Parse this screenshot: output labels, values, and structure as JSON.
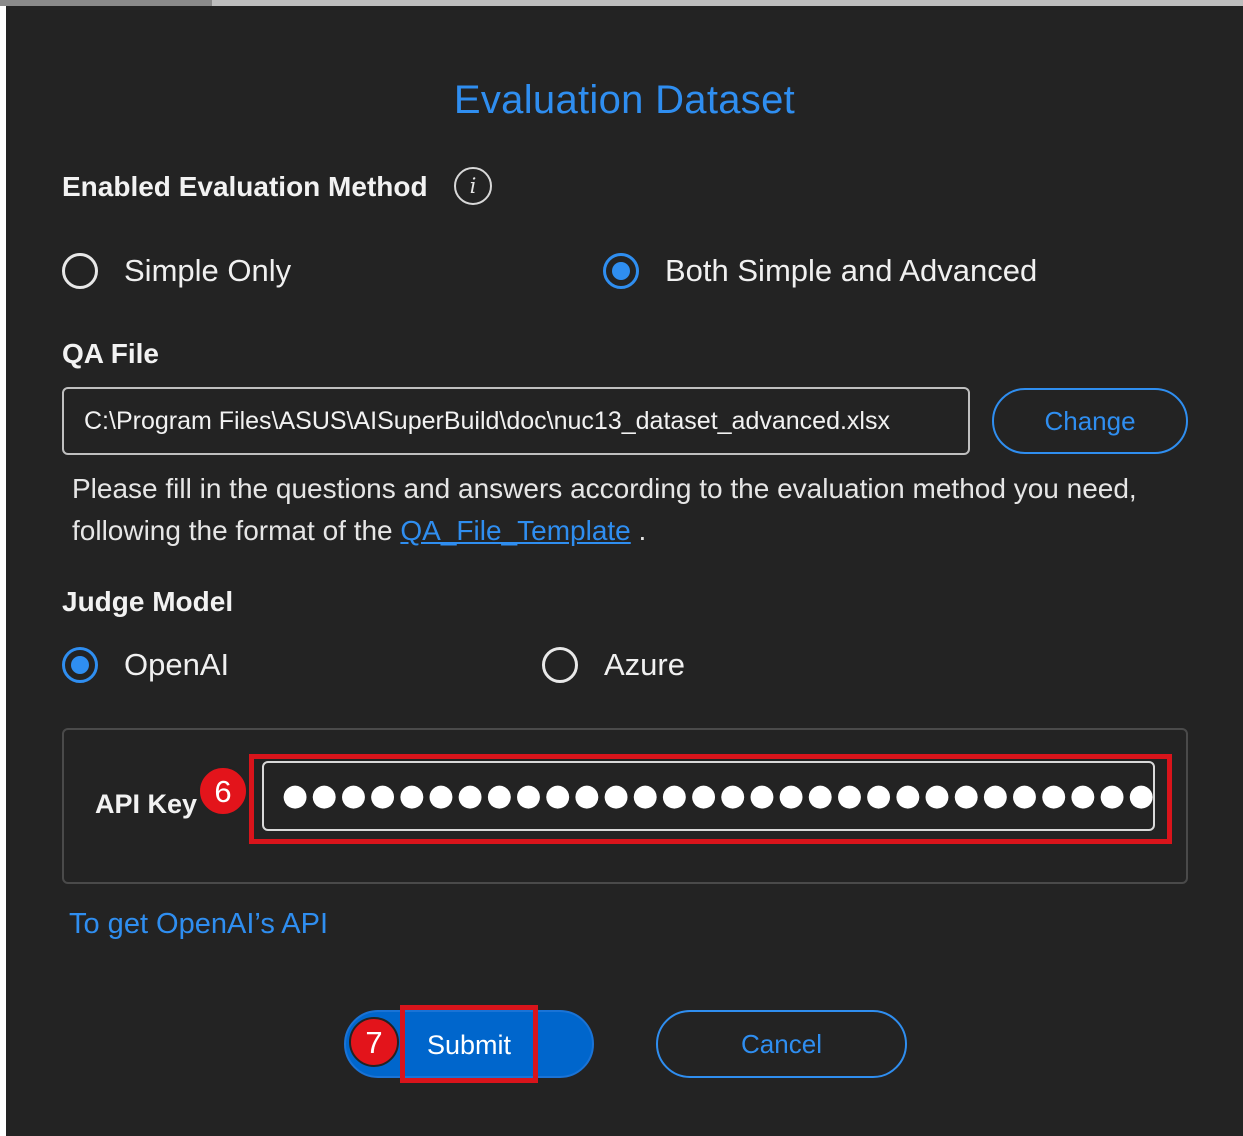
{
  "dialog": {
    "title": "Evaluation Dataset"
  },
  "evaluation_method": {
    "label": "Enabled Evaluation Method",
    "info_icon": "info-icon",
    "options": [
      {
        "label": "Simple Only",
        "selected": false
      },
      {
        "label": "Both Simple and Advanced",
        "selected": true
      }
    ]
  },
  "qa_file": {
    "label": "QA File",
    "path": "C:\\Program Files\\ASUS\\AISuperBuild\\doc\\nuc13_dataset_advanced.xlsx",
    "change_label": "Change",
    "help_text": "Please fill in the questions and answers according to the evaluation method you need, following the format of the",
    "template_link": "QA_File_Template",
    "help_suffix": "."
  },
  "judge_model": {
    "label": "Judge Model",
    "options": [
      {
        "label": "OpenAI",
        "selected": true
      },
      {
        "label": "Azure",
        "selected": false
      }
    ]
  },
  "api_key": {
    "label": "API Key",
    "masked_value": "●●●●●●●●●●●●●●●●●●●●●●●●●●●●●●●●●●●●●"
  },
  "openai_link": "To get OpenAI’s API",
  "actions": {
    "submit_label": "Submit",
    "cancel_label": "Cancel"
  },
  "annotations": {
    "step_api": "6",
    "step_submit": "7",
    "highlight_color": "#d9141b"
  },
  "colors": {
    "accent": "#2f8ef0",
    "background": "#232323",
    "primary_button": "#0066cc"
  }
}
